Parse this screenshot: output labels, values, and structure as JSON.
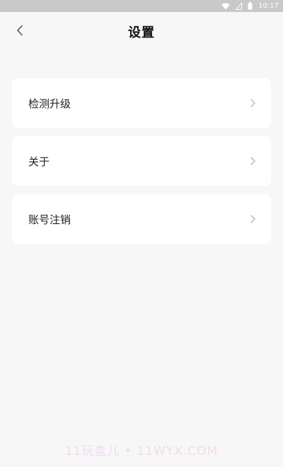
{
  "status_bar": {
    "time": "10:17",
    "icons": [
      "wifi-icon",
      "signal-icon",
      "battery-icon"
    ]
  },
  "header": {
    "title": "设置",
    "back_icon": "chevron-left-icon"
  },
  "settings": {
    "items": [
      {
        "label": "检测升级",
        "icon": "chevron-right-icon"
      },
      {
        "label": "关于",
        "icon": "chevron-right-icon"
      },
      {
        "label": "账号注销",
        "icon": "chevron-right-icon"
      }
    ]
  },
  "watermark": {
    "text": "11玩盒儿 • 11WYX.COM"
  },
  "colors": {
    "background": "#f7f7f8",
    "card": "#ffffff",
    "status_bar": "#c9c9c9",
    "chevron": "#b5b5b5"
  }
}
